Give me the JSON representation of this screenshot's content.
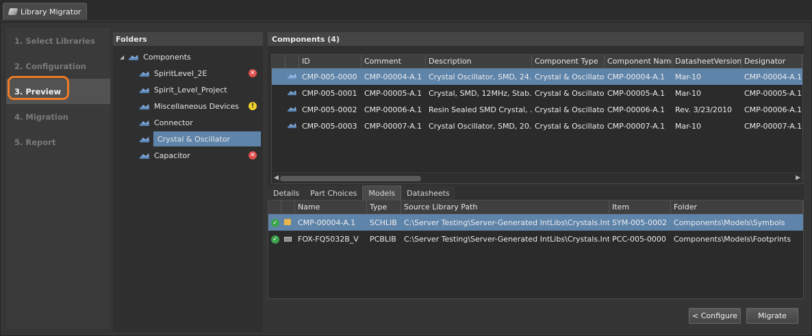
{
  "window": {
    "tab_title": "Library Migrator"
  },
  "steps": [
    {
      "label": "1. Select Libraries"
    },
    {
      "label": "2. Configuration"
    },
    {
      "label": "3. Preview"
    },
    {
      "label": "4. Migration"
    },
    {
      "label": "5. Report"
    }
  ],
  "folders": {
    "title": "Folders",
    "root": "Components",
    "items": [
      {
        "label": "SpiritLevel_2E",
        "status": "error"
      },
      {
        "label": "Spirit_Level_Project",
        "status": ""
      },
      {
        "label": "Miscellaneous Devices",
        "status": "warning"
      },
      {
        "label": "Connector",
        "status": ""
      },
      {
        "label": "Crystal & Oscillator",
        "status": ""
      },
      {
        "label": "Capacitor",
        "status": "error"
      }
    ]
  },
  "components": {
    "title": "Components (4)",
    "columns": [
      "ID",
      "Comment",
      "Description",
      "Component Type",
      "Component Name",
      "DatasheetVersion",
      "Designator"
    ],
    "rows": [
      [
        "CMP-005-0000",
        "CMP-00004-A.1",
        "Crystal Oscillator, SMD, 24...",
        "Crystal & Oscillator",
        "CMP-00004-A.1",
        "Mar-10",
        "CMP-00004-A.1"
      ],
      [
        "CMP-005-0001",
        "CMP-00005-A.1",
        "Crystal, SMD, 12MHz, Stab...",
        "Crystal & Oscillator",
        "CMP-00005-A.1",
        "Mar-10",
        "CMP-00005-A.1"
      ],
      [
        "CMP-005-0002",
        "CMP-00006-A.1",
        "Resin Sealed SMD Crystal, ...",
        "Crystal & Oscillator",
        "CMP-00006-A.1",
        "Rev. 3/23/2010",
        "CMP-00006-A.1"
      ],
      [
        "CMP-005-0003",
        "CMP-00007-A.1",
        "Crystal Oscillator, SMD, 20...",
        "Crystal & Oscillator",
        "CMP-00007-A.1",
        "Mar-10",
        "CMP-00007-A.1"
      ]
    ]
  },
  "detail_tabs": [
    "Details",
    "Part Choices",
    "Models",
    "Datasheets"
  ],
  "models": {
    "columns": [
      "Name",
      "Type",
      "Source Library Path",
      "Item",
      "Folder"
    ],
    "rows": [
      [
        "CMP-00004-A.1",
        "SCHLIB",
        "C:\\Server Testing\\Server-Generated IntLibs\\Crystals.IntLib",
        "SYM-005-0002",
        "Components\\Models\\Symbols"
      ],
      [
        "FOX-FQ5032B_V",
        "PCBLIB",
        "C:\\Server Testing\\Server-Generated IntLibs\\Crystals.IntLib",
        "PCC-005-0000",
        "Components\\Models\\Footprints"
      ]
    ]
  },
  "buttons": {
    "configure": "< Configure",
    "migrate": "Migrate"
  },
  "colors": {
    "accent": "#f07b22",
    "selection": "#5f84aa"
  },
  "icons": {
    "component": "component-icon",
    "error": "error-icon",
    "warning": "warning-icon",
    "ok": "ok-check-icon"
  }
}
